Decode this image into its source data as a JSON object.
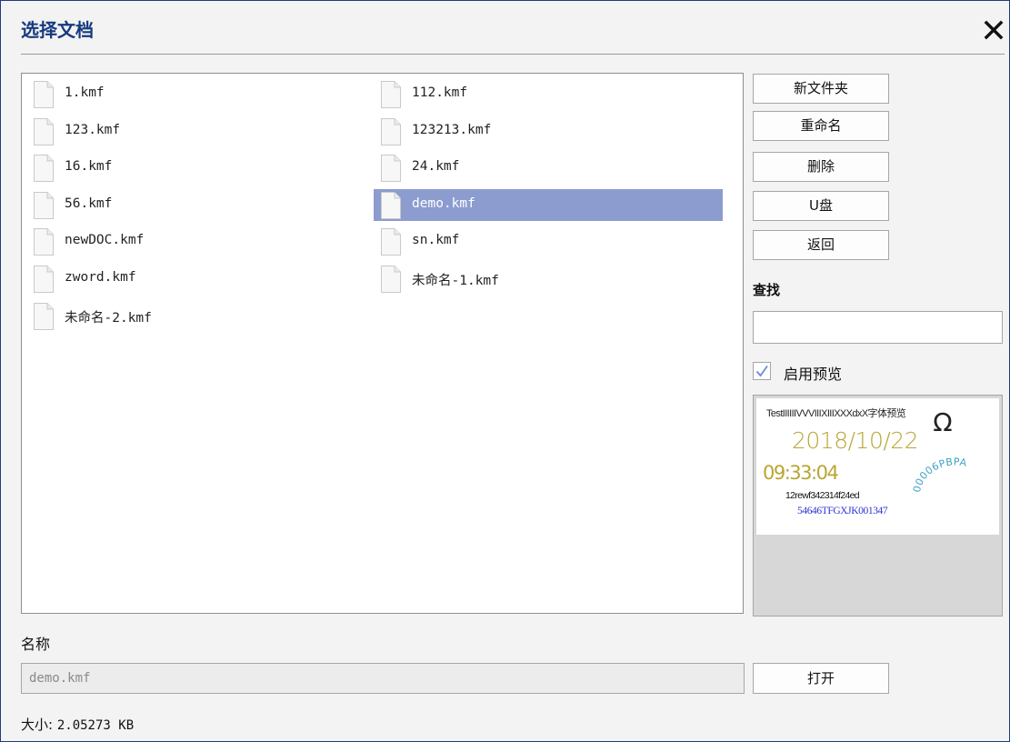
{
  "dialog": {
    "title": "选择文档",
    "close_icon": "close-icon"
  },
  "files": [
    {
      "name": "1.kmf",
      "selected": false
    },
    {
      "name": "112.kmf",
      "selected": false
    },
    {
      "name": "123.kmf",
      "selected": false
    },
    {
      "name": "123213.kmf",
      "selected": false
    },
    {
      "name": "16.kmf",
      "selected": false
    },
    {
      "name": "24.kmf",
      "selected": false
    },
    {
      "name": "56.kmf",
      "selected": false
    },
    {
      "name": "demo.kmf",
      "selected": true
    },
    {
      "name": "newDOC.kmf",
      "selected": false
    },
    {
      "name": "sn.kmf",
      "selected": false
    },
    {
      "name": "zword.kmf",
      "selected": false
    },
    {
      "name": "未命名-1.kmf",
      "selected": false
    },
    {
      "name": "未命名-2.kmf",
      "selected": false
    }
  ],
  "actions": {
    "new_folder": "新文件夹",
    "rename": "重命名",
    "delete": "删除",
    "usb": "U盘",
    "back": "返回"
  },
  "search": {
    "label": "查找",
    "value": "",
    "placeholder": ""
  },
  "preview": {
    "toggle_label": "启用预览",
    "enabled": true,
    "content": {
      "line1": "TestIIIIIIVVVIIIXIIIXXXdxX字体预览",
      "date": "2018/10/22",
      "time": "09:33:04",
      "code1": "12rewf342314f24ed",
      "code2": "54646TFGXJK001347",
      "symbol": "Ω",
      "arc_text": "00006PBPA"
    },
    "colors": {
      "date": "#b8a634",
      "arc": "#3fa3c5",
      "code2": "#3032d8"
    }
  },
  "footer": {
    "name_label": "名称",
    "name_value": "demo.kmf",
    "open_button": "打开",
    "size_label": "大小:",
    "size_value": "2.05273 KB"
  },
  "colors": {
    "title": "#173a7e",
    "selection": "#8c9ccf",
    "frame": "#1f3d7a"
  }
}
